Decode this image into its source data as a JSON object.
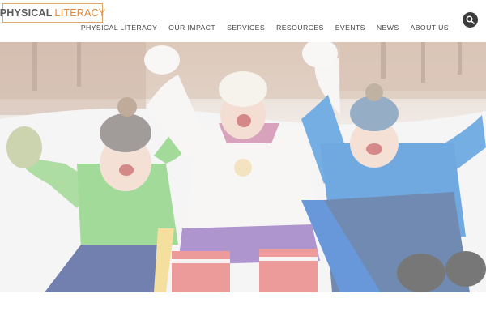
{
  "header": {
    "logo": {
      "word1": "PHYSICAL",
      "word2": "LITERACY"
    },
    "search": {
      "icon": "search-icon"
    }
  },
  "nav": {
    "items": [
      {
        "label": "PHYSICAL LITERACY"
      },
      {
        "label": "OUR IMPACT"
      },
      {
        "label": "SERVICES"
      },
      {
        "label": "RESOURCES"
      },
      {
        "label": "EVENTS"
      },
      {
        "label": "NEWS"
      },
      {
        "label": "ABOUT US"
      }
    ]
  },
  "colors": {
    "logo_border": "#e0a565",
    "logo_accent": "#e08a3b",
    "nav_text": "#444444",
    "search_bg": "#3b3b3b"
  }
}
